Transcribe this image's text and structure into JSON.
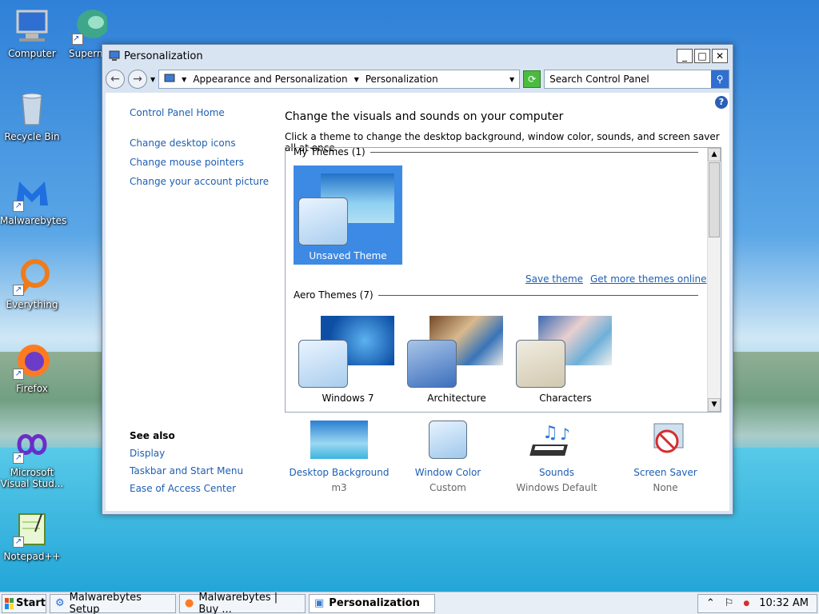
{
  "desktop": {
    "icons": [
      {
        "label": "Computer"
      },
      {
        "label": "Superm"
      },
      {
        "label": "Recycle Bin"
      },
      {
        "label": "Malwarebytes"
      },
      {
        "label": "Everything"
      },
      {
        "label": "Firefox"
      },
      {
        "label": "Microsoft Visual Stud..."
      },
      {
        "label": "Notepad++"
      }
    ]
  },
  "window": {
    "title": "Personalization",
    "controls": {
      "minimize": "_",
      "maximize": "□",
      "close": "✕"
    },
    "address": {
      "crumbs": [
        "Appearance and Personalization",
        "Personalization"
      ],
      "search_placeholder": "Search Control Panel"
    },
    "left_nav": {
      "home": "Control Panel Home",
      "links": [
        "Change desktop icons",
        "Change mouse pointers",
        "Change your account picture"
      ]
    },
    "see_also": {
      "heading": "See also",
      "links": [
        "Display",
        "Taskbar and Start Menu",
        "Ease of Access Center"
      ]
    },
    "heading": "Change the visuals and sounds on your computer",
    "subheading": "Click a theme to change the desktop background, window color, sounds, and screen saver all at once.",
    "my_themes": {
      "title": "My Themes (1)",
      "items": [
        {
          "label": "Unsaved Theme"
        }
      ],
      "save_link": "Save theme",
      "more_link": "Get more themes online"
    },
    "aero_themes": {
      "title": "Aero Themes (7)",
      "items": [
        {
          "label": "Windows 7"
        },
        {
          "label": "Architecture"
        },
        {
          "label": "Characters"
        }
      ]
    },
    "bottom": [
      {
        "label": "Desktop Background",
        "value": "m3"
      },
      {
        "label": "Window Color",
        "value": "Custom"
      },
      {
        "label": "Sounds",
        "value": "Windows Default"
      },
      {
        "label": "Screen Saver",
        "value": "None"
      }
    ]
  },
  "taskbar": {
    "start": "Start",
    "tasks": [
      {
        "label": "Malwarebytes Setup"
      },
      {
        "label": "Malwarebytes | Buy ..."
      },
      {
        "label": "Personalization"
      }
    ],
    "clock": "10:32 AM"
  }
}
